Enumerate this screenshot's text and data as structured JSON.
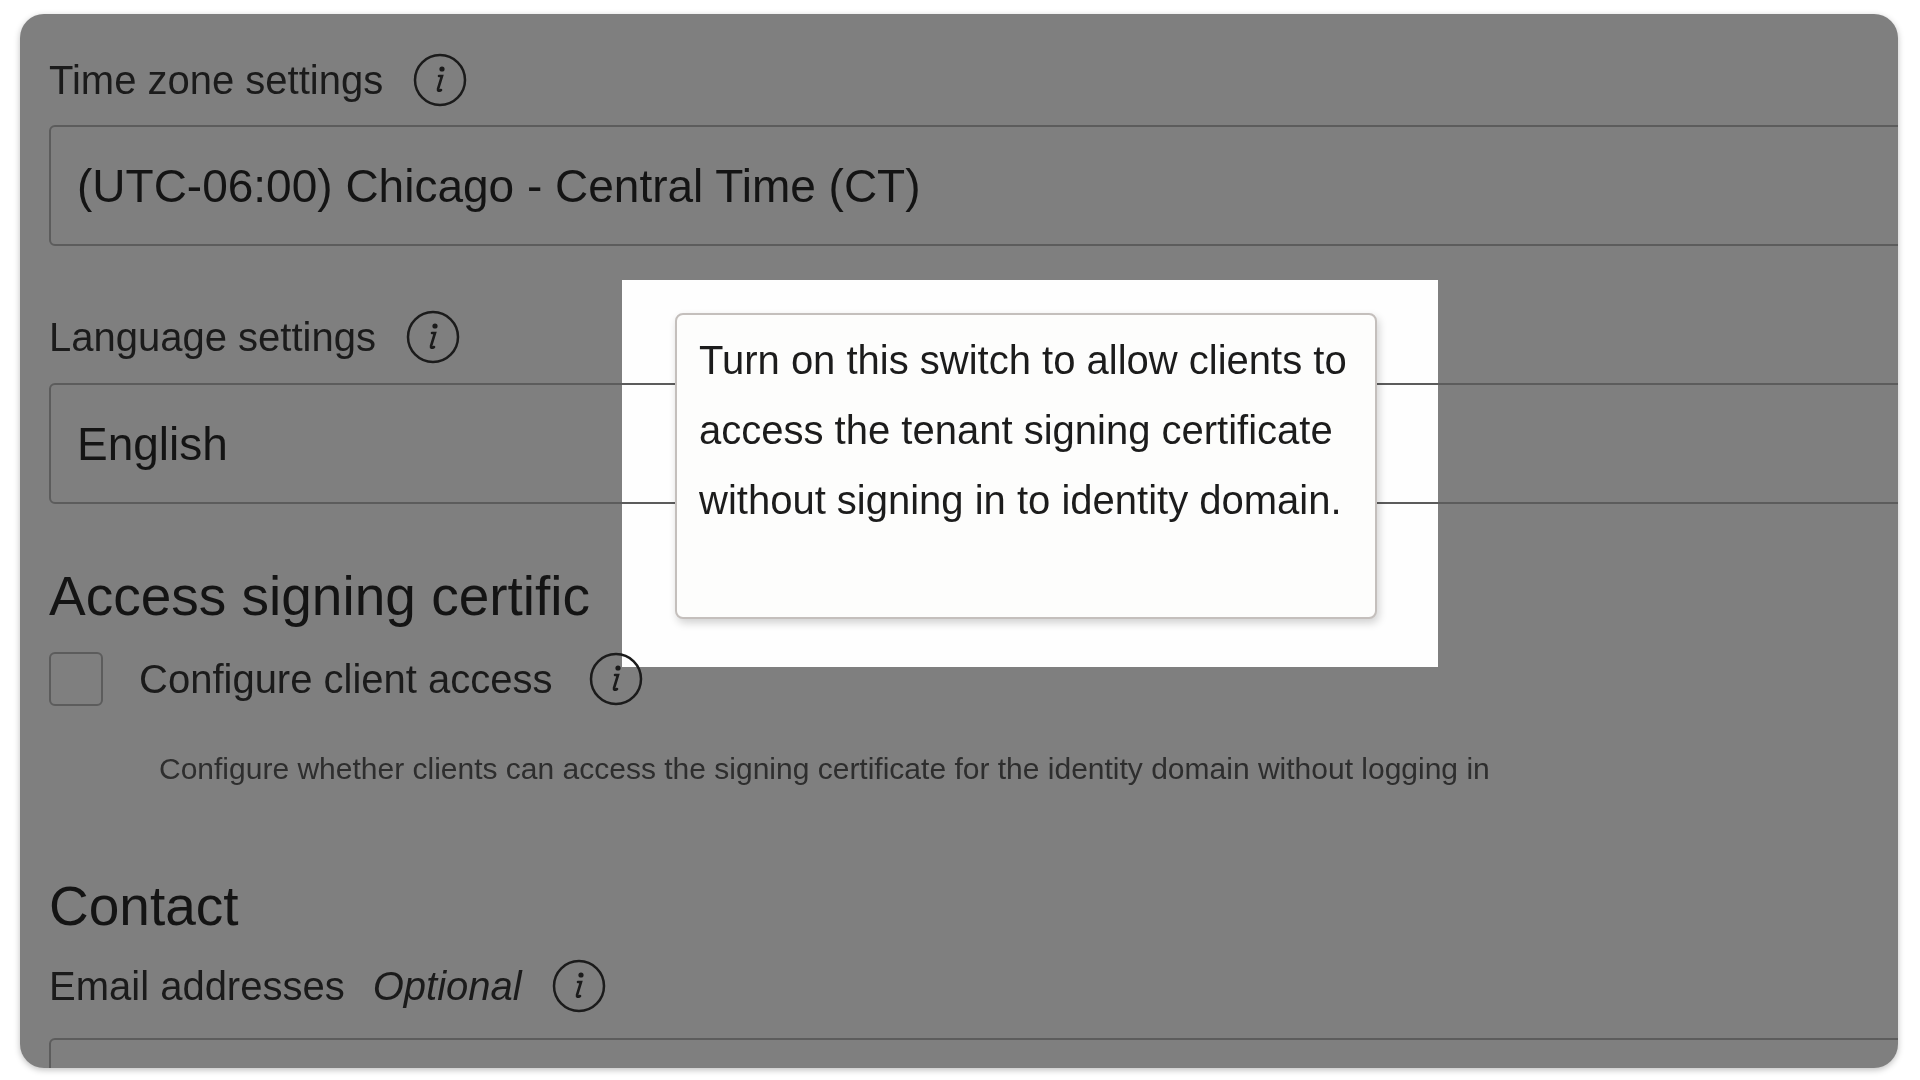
{
  "time_zone": {
    "label": "Time zone settings",
    "value": "(UTC-06:00) Chicago - Central Time (CT)"
  },
  "language": {
    "label": "Language settings",
    "value": "English"
  },
  "access_signing_certificate": {
    "heading": "Access signing certific",
    "checkbox": {
      "label": "Configure client access",
      "checked": false
    },
    "description": "Configure whether clients can access the signing certificate for the identity domain without logging in"
  },
  "contact": {
    "heading": "Contact",
    "email": {
      "label": "Email addresses",
      "optional": "Optional"
    }
  },
  "tooltip": {
    "text": "Turn on this switch to allow clients to access the tenant signing certificate without signing in to identity domain."
  }
}
